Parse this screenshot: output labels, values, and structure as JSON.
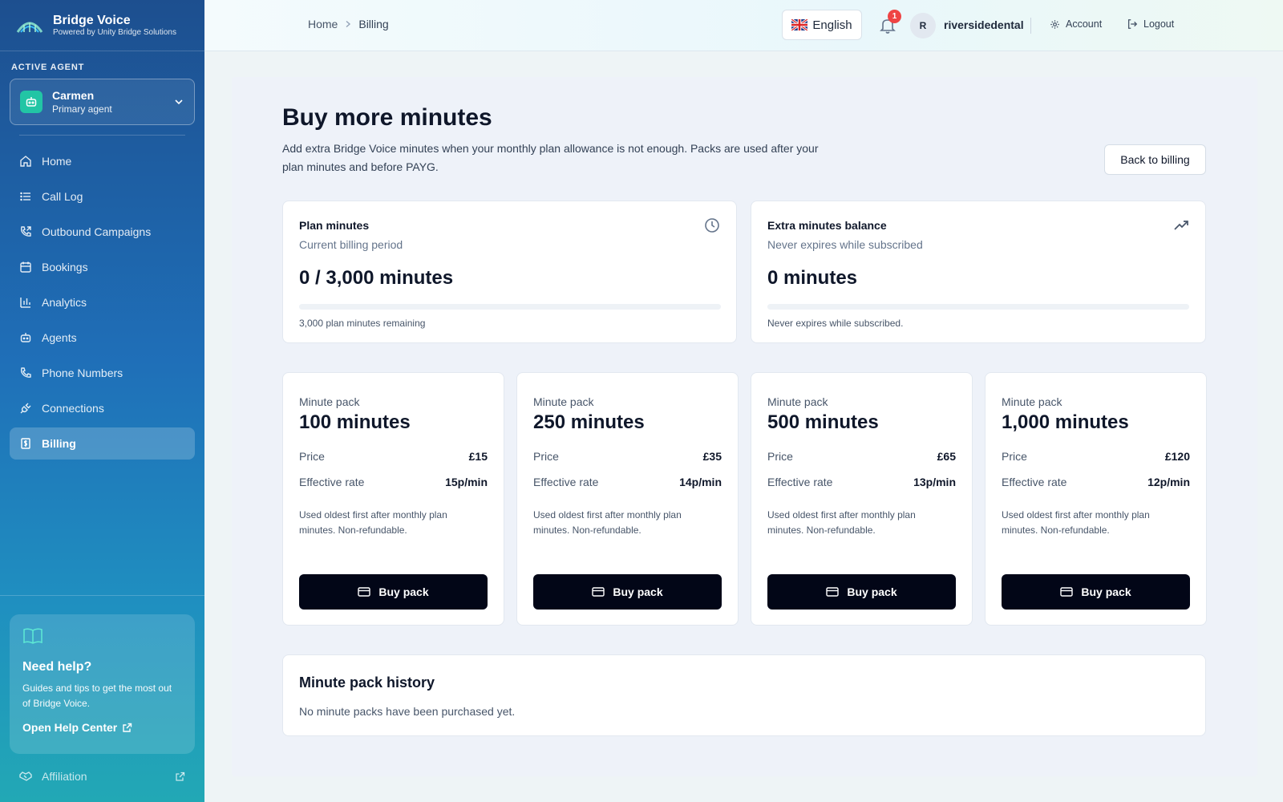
{
  "brand": {
    "name": "Bridge Voice",
    "tagline": "Powered by Unity Bridge Solutions"
  },
  "sidebar": {
    "active_agent_label": "ACTIVE AGENT",
    "agent": {
      "name": "Carmen",
      "role": "Primary agent"
    },
    "items": [
      {
        "label": "Home",
        "icon": "home-icon"
      },
      {
        "label": "Call Log",
        "icon": "list-icon"
      },
      {
        "label": "Outbound Campaigns",
        "icon": "phone-outgoing-icon"
      },
      {
        "label": "Bookings",
        "icon": "calendar-icon"
      },
      {
        "label": "Analytics",
        "icon": "bar-chart-icon"
      },
      {
        "label": "Agents",
        "icon": "bot-icon"
      },
      {
        "label": "Phone Numbers",
        "icon": "phone-icon"
      },
      {
        "label": "Connections",
        "icon": "plug-icon"
      },
      {
        "label": "Billing",
        "icon": "receipt-icon",
        "active": true
      }
    ],
    "help": {
      "title": "Need help?",
      "text": "Guides and tips to get the most out of Bridge Voice.",
      "link": "Open Help Center"
    },
    "affiliation": "Affiliation"
  },
  "header": {
    "breadcrumb": [
      "Home",
      "Billing"
    ],
    "language": "English",
    "notification_count": "1",
    "avatar_initial": "R",
    "username": "riversidedental",
    "account_label": "Account",
    "logout_label": "Logout"
  },
  "main": {
    "title": "Buy more minutes",
    "description": "Add extra Bridge Voice minutes when your monthly plan allowance is not enough. Packs are used after your plan minutes and before PAYG.",
    "back_button": "Back to billing",
    "plan": {
      "title": "Plan minutes",
      "subtitle": "Current billing period",
      "value": "0 / 3,000 minutes",
      "progress": 0,
      "note": "3,000 plan minutes remaining"
    },
    "extra": {
      "title": "Extra minutes balance",
      "subtitle": "Never expires while subscribed",
      "value": "0 minutes",
      "progress": 0,
      "note": "Never expires while subscribed."
    },
    "packs": [
      {
        "label": "Minute pack",
        "title": "100 minutes",
        "price_label": "Price",
        "price": "£15",
        "rate_label": "Effective rate",
        "rate": "15p/min",
        "note": "Used oldest first after monthly plan minutes. Non-refundable.",
        "button": "Buy pack"
      },
      {
        "label": "Minute pack",
        "title": "250 minutes",
        "price_label": "Price",
        "price": "£35",
        "rate_label": "Effective rate",
        "rate": "14p/min",
        "note": "Used oldest first after monthly plan minutes. Non-refundable.",
        "button": "Buy pack"
      },
      {
        "label": "Minute pack",
        "title": "500 minutes",
        "price_label": "Price",
        "price": "£65",
        "rate_label": "Effective rate",
        "rate": "13p/min",
        "note": "Used oldest first after monthly plan minutes. Non-refundable.",
        "button": "Buy pack"
      },
      {
        "label": "Minute pack",
        "title": "1,000 minutes",
        "price_label": "Price",
        "price": "£120",
        "rate_label": "Effective rate",
        "rate": "12p/min",
        "note": "Used oldest first after monthly plan minutes. Non-refundable.",
        "button": "Buy pack"
      }
    ],
    "history": {
      "title": "Minute pack history",
      "empty": "No minute packs have been purchased yet."
    }
  }
}
